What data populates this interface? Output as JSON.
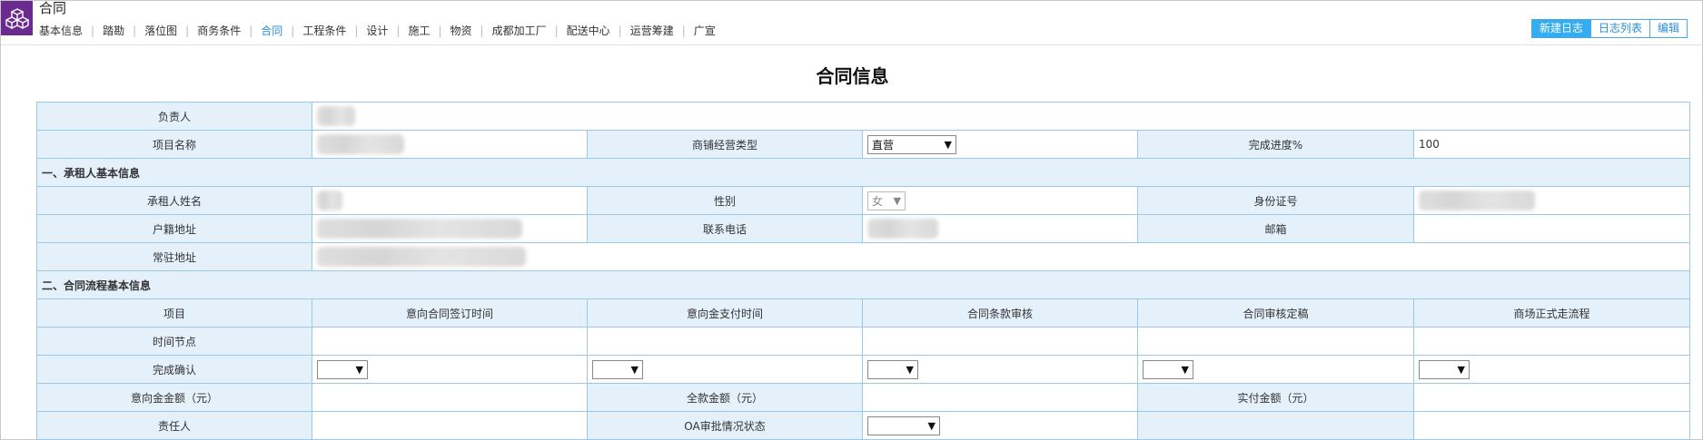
{
  "app": {
    "title": "合同",
    "icon": "cubes-icon"
  },
  "nav": {
    "tabs": [
      "基本信息",
      "踏勘",
      "落位图",
      "商务条件",
      "合同",
      "工程条件",
      "设计",
      "施工",
      "物资",
      "成都加工厂",
      "配送中心",
      "运营筹建",
      "广宣"
    ],
    "active_index": 4
  },
  "toolbar": {
    "new_log": "新建日志",
    "log_list": "日志列表",
    "edit": "编辑"
  },
  "page": {
    "title": "合同信息"
  },
  "form": {
    "owner_label": "负责人",
    "project_name_label": "项目名称",
    "shop_type_label": "商铺经营类型",
    "shop_type_value": "直营",
    "progress_label": "完成进度%",
    "progress_value": "100",
    "section1": "一、承租人基本信息",
    "tenant_name_label": "承租人姓名",
    "gender_label": "性别",
    "gender_value": "女",
    "id_label": "身份证号",
    "hukou_label": "户籍地址",
    "phone_label": "联系电话",
    "email_label": "邮箱",
    "residence_label": "常驻地址",
    "section2": "二、合同流程基本信息",
    "headers": [
      "项目",
      "意向合同签订时间",
      "意向金支付时间",
      "合同条款审核",
      "合同审核定稿",
      "商场正式走流程"
    ],
    "time_node_label": "时间节点",
    "confirm_label": "完成确认",
    "deposit_label": "意向金金额（元）",
    "full_amount_label": "全款金额（元）",
    "paid_amount_label": "实付金额（元）",
    "responsible_label": "责任人",
    "oa_label": "OA审批情况状态"
  }
}
